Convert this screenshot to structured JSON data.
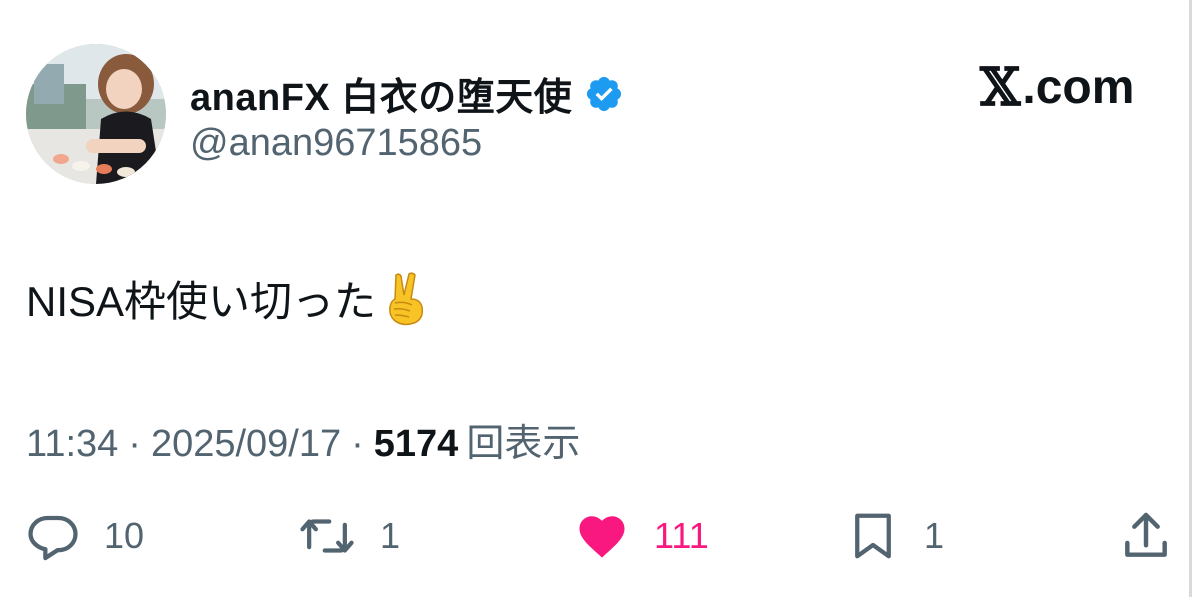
{
  "tweet": {
    "author": {
      "display_name": "ananFX 白衣の堕天使",
      "handle": "@anan96715865",
      "verified": true,
      "avatar_icon": "profile-photo"
    },
    "brand": {
      "symbol": "𝕏",
      "label": ".com"
    },
    "text": "NISA枠使い切った",
    "emoji": "victory-hand",
    "meta": {
      "time": "11:34",
      "separator": "·",
      "date": "2025/09/17",
      "views_count": "5174",
      "views_label": "回表示"
    },
    "actions": {
      "reply_count": "10",
      "retweet_count": "1",
      "like_count": "111",
      "bookmark_count": "1"
    }
  },
  "colors": {
    "verified": "#1d9bf0",
    "like": "#f91880",
    "secondary_text": "#536471",
    "primary_text": "#0f1419"
  }
}
